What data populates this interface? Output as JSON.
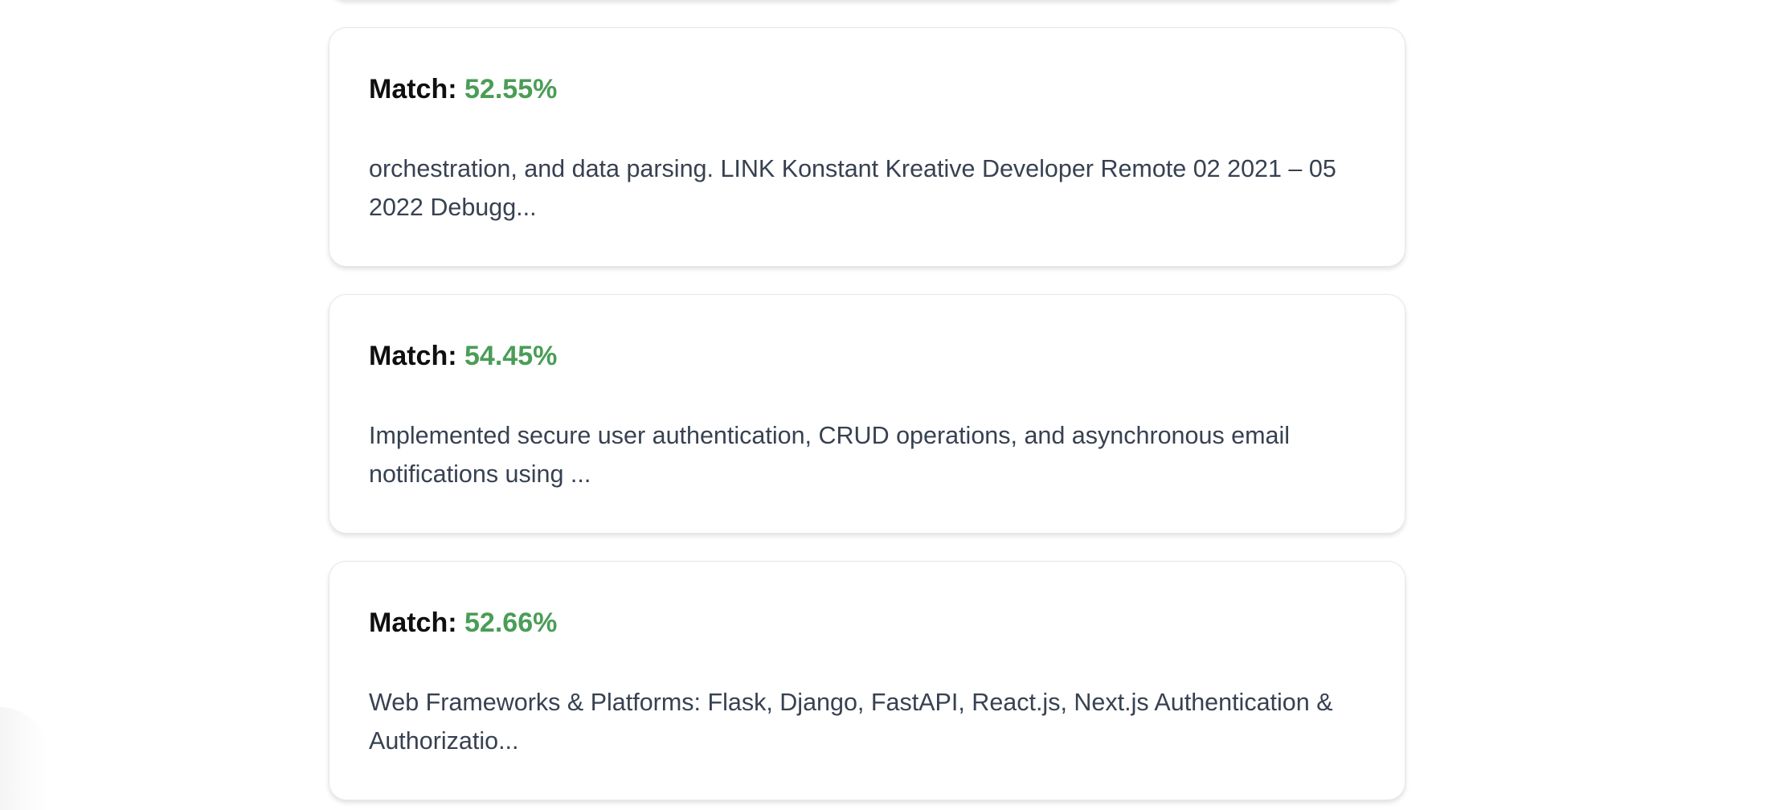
{
  "results": [
    {
      "match_label": "Match:",
      "match_value": "52.55%",
      "snippet": "orchestration, and data parsing. LINK Konstant Kreative Developer Remote 02 2021 – 05 2022 Debugg..."
    },
    {
      "match_label": "Match:",
      "match_value": "54.45%",
      "snippet": "Implemented secure user authentication, CRUD operations, and asynchronous email notifications using ..."
    },
    {
      "match_label": "Match:",
      "match_value": "52.66%",
      "snippet": "Web Frameworks & Platforms: Flask, Django, FastAPI, React.js, Next.js Authentication & Authorizatio..."
    }
  ],
  "colors": {
    "match_value": "#4a9d56",
    "snippet_text": "#374151",
    "card_border": "#e5e7eb"
  }
}
